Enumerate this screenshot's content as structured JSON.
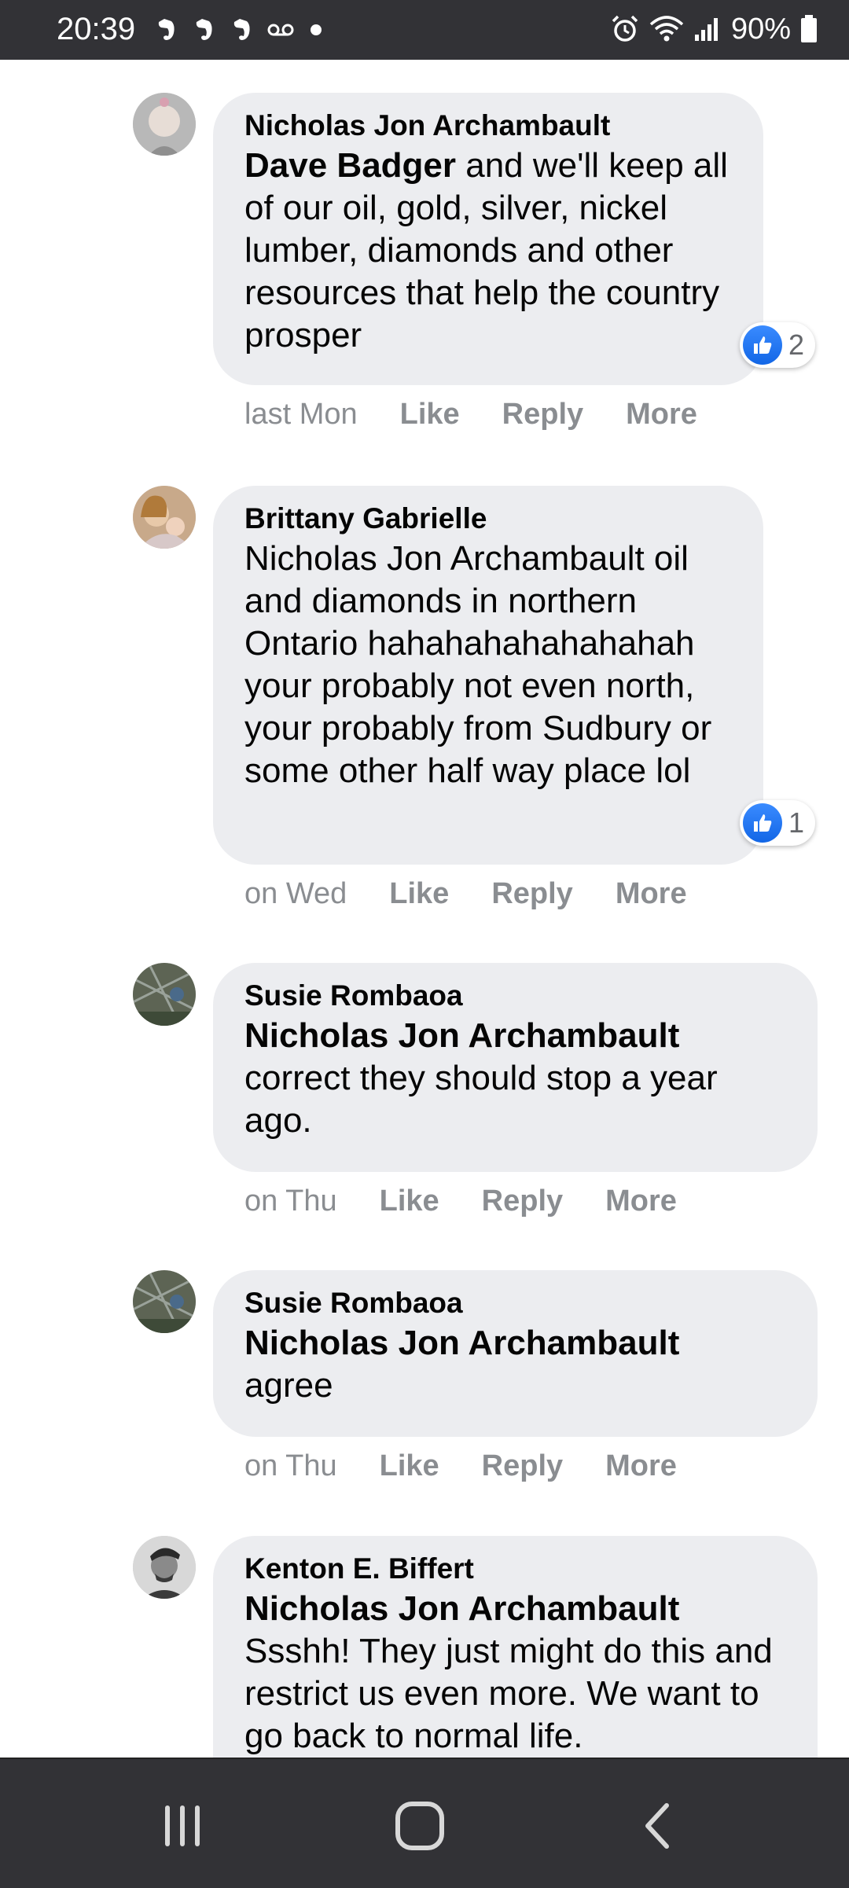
{
  "status_bar": {
    "time": "20:39",
    "notification_icons": [
      "evernote-icon",
      "evernote-icon",
      "evernote-icon",
      "voicemail-icon",
      "dot-icon"
    ],
    "battery_percent": "90%"
  },
  "comments": [
    {
      "author": "Nicholas Jon Archambault",
      "mention": "Dave Badger",
      "text": " and we'll keep all of our oil, gold, silver, nickel lumber, diamonds and other resources that help the country prosper",
      "time": "last Mon",
      "like_label": "Like",
      "reply_label": "Reply",
      "more_label": "More",
      "reactions": "2"
    },
    {
      "author": "Brittany Gabrielle",
      "mention": "",
      "text": "Nicholas Jon Archambault oil and diamonds in northern Ontario hahahahahahahahah your probably not even north, your probably from Sudbury or some other half way place lol",
      "time": "on Wed",
      "like_label": "Like",
      "reply_label": "Reply",
      "more_label": "More",
      "reactions": "1"
    },
    {
      "author": "Susie Rombaoa",
      "mention": "Nicholas Jon Archambault",
      "text": "correct they should stop a year ago.",
      "time": "on Thu",
      "like_label": "Like",
      "reply_label": "Reply",
      "more_label": "More"
    },
    {
      "author": "Susie Rombaoa",
      "mention": "Nicholas Jon Archambault",
      "text": "agree",
      "time": "on Thu",
      "like_label": "Like",
      "reply_label": "Reply",
      "more_label": "More"
    },
    {
      "author": "Kenton E. Biffert",
      "mention": "Nicholas Jon Archambault",
      "text": "Ssshh! They just might do this and restrict us even more. We want to go back to normal life."
    }
  ],
  "colors": {
    "bubble": "#ecedf0",
    "meta_text": "#8a8d91",
    "like_blue": "#1877f2",
    "system_bar": "#323236"
  },
  "nav_bar": [
    "recent-apps-icon",
    "home-icon",
    "back-icon"
  ]
}
